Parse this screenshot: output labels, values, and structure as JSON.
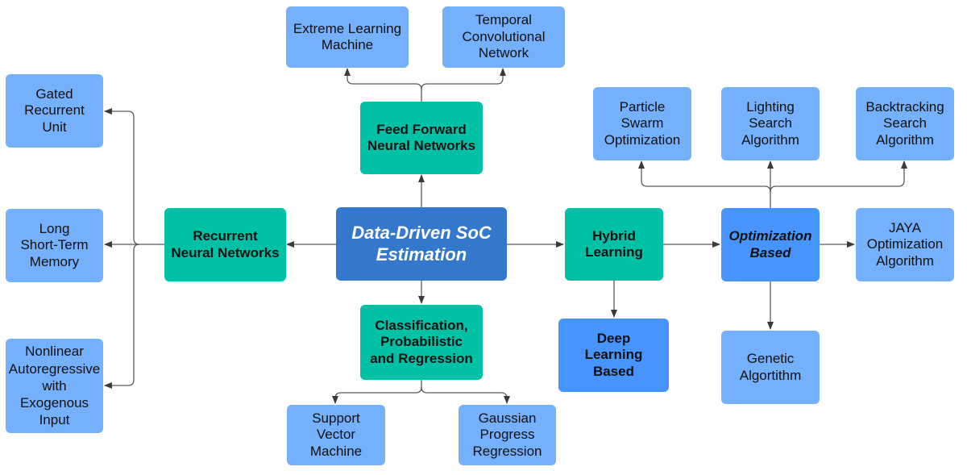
{
  "diagram": {
    "root": "Data-Driven SoC\nEstimation",
    "categories": {
      "rnn": "Recurrent\nNeural Networks",
      "ffnn": "Feed Forward\nNeural Networks",
      "cpr": "Classification,\nProbabilistic\nand Regression",
      "hybrid": "Hybrid\nLearning"
    },
    "hybrid_children": {
      "deep": "Deep\nLearning\nBased",
      "optimization": "Optimization\nBased"
    },
    "leaves": {
      "gru": "Gated\nRecurrent\nUnit",
      "lstm": "Long\nShort-Term\nMemory",
      "narx": "Nonlinear\nAutoregressive\nwith\nExogenous\nInput",
      "elm": "Extreme Learning\nMachine",
      "tcn": "Temporal\nConvolutional\nNetwork",
      "svm": "Support\nVector\nMachine",
      "gpr": "Gaussian\nProgress\nRegression",
      "pso": "Particle\nSwarm\nOptimization",
      "lsa": "Lighting\nSearch\nAlgorithm",
      "bsa": "Backtracking\nSearch\nAlgorithm",
      "jaya": "JAYA\nOptimization\nAlgorithm",
      "ga": "Genetic\nAlgortithm"
    },
    "colors": {
      "leaf": "#75b0fd",
      "category": "#00c1a6",
      "root": "#3478cb",
      "sub_category": "#4795fc",
      "edge": "#555555"
    }
  }
}
